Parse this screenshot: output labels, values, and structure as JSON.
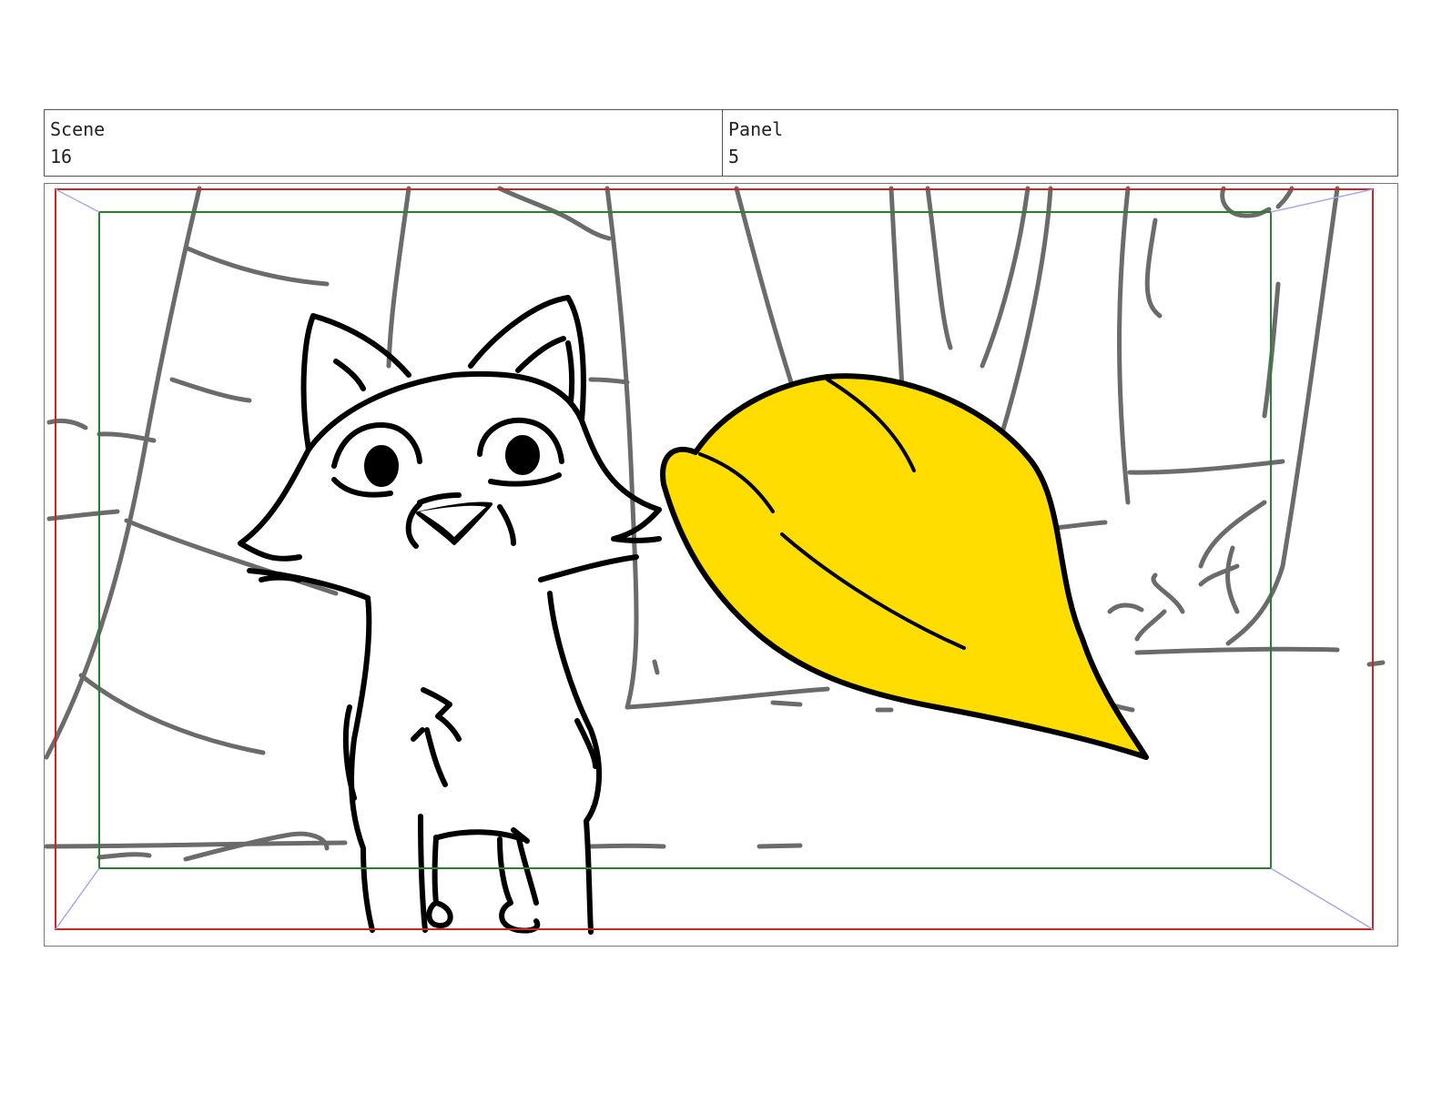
{
  "header": {
    "scene_label": "Scene",
    "scene_value": "16",
    "panel_label": "Panel",
    "panel_value": "5"
  },
  "colors": {
    "safe_area": "#c62828",
    "action_safe": "#2e7d32",
    "fill_yellow": "#ffdd00",
    "background_lines": "#6b6b6b",
    "ink": "#000000"
  }
}
